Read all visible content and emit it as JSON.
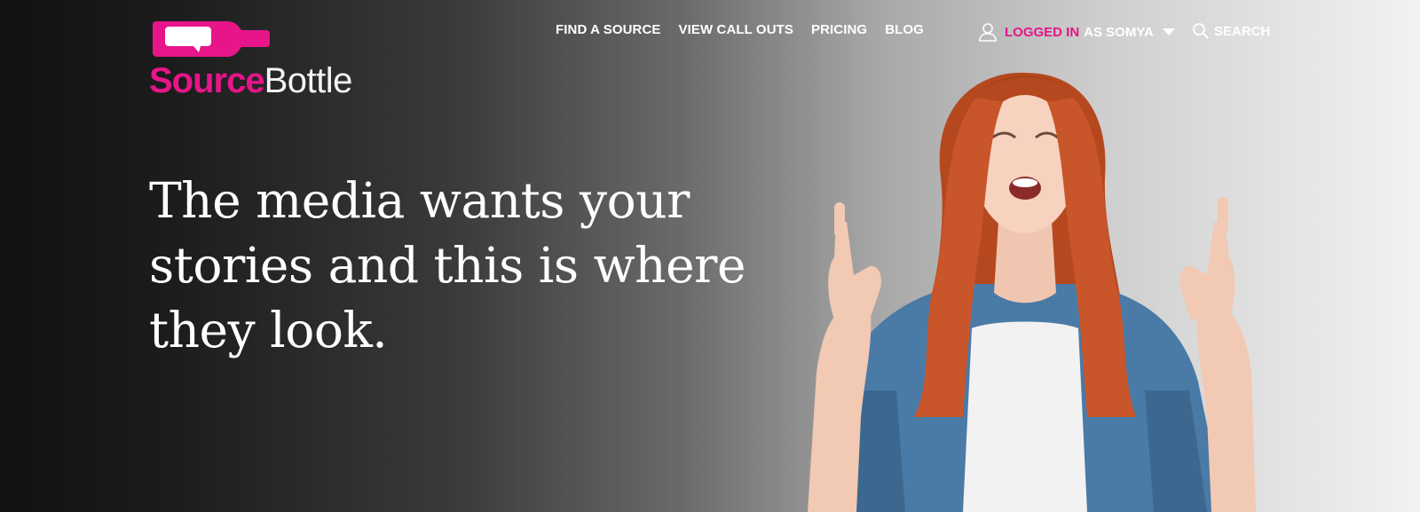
{
  "brand": {
    "name_part1": "Source",
    "name_part2": "Bottle",
    "accent_color": "#e6158a"
  },
  "nav": {
    "items": [
      {
        "label": "FIND A SOURCE"
      },
      {
        "label": "VIEW CALL OUTS"
      },
      {
        "label": "PRICING"
      },
      {
        "label": "BLOG"
      }
    ]
  },
  "user": {
    "logged_in_label": "LOGGED IN",
    "as_label": "AS SOMYA",
    "icon": "user-icon",
    "menu_icon": "caret-down-icon"
  },
  "search": {
    "label": "SEARCH",
    "icon": "search-icon"
  },
  "hero": {
    "headline": "The media wants your stories and this is where they look.",
    "image": "woman-pointing-up-photo"
  }
}
